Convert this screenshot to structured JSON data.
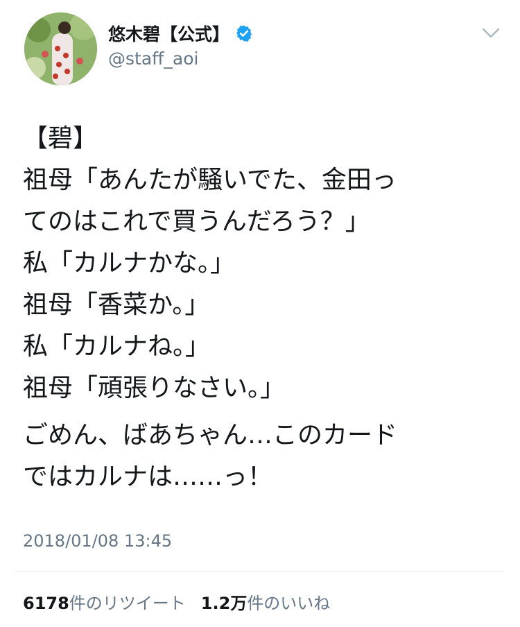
{
  "user": {
    "name": "悠木碧【公式】",
    "handle": "@staff_aoi",
    "verified": true,
    "verified_color": "#1da1f2"
  },
  "tweet": {
    "lines": [
      "【碧】",
      "祖母「あんたが騒いでた、金田っ",
      "てのはこれで買うんだろう？」",
      "私「カルナかな。」",
      "祖母「香菜か。」",
      "私「カルナね。」",
      "祖母「頑張りなさい。」"
    ],
    "lines2": [
      "ごめん、ばあちゃん…このカード",
      "ではカルナは……っ！"
    ]
  },
  "timestamp": "2018/01/08 13:45",
  "stats": {
    "retweets_count": "6178",
    "retweets_label": "件のリツイート",
    "likes_count": "1.2万",
    "likes_label": "件のいいね"
  },
  "icons": {
    "verified": "verified-badge-icon",
    "more": "chevron-down-icon"
  }
}
